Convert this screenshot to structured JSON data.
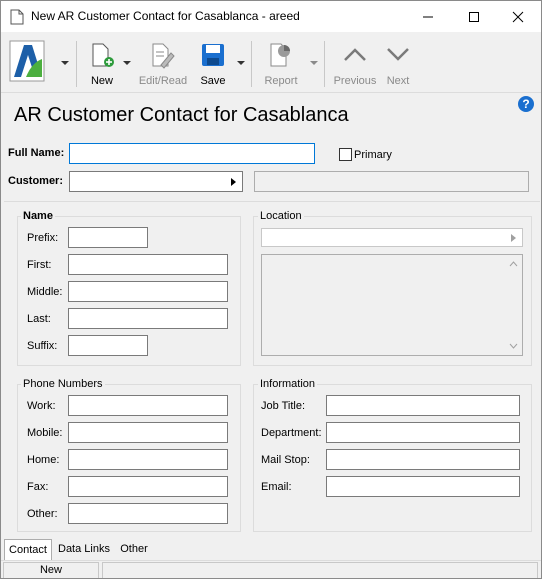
{
  "window": {
    "title": "New AR Customer Contact for Casablanca - areed"
  },
  "toolbar": {
    "new_label": "New",
    "edit_read_label": "Edit/Read",
    "save_label": "Save",
    "report_label": "Report",
    "previous_label": "Previous",
    "next_label": "Next"
  },
  "page": {
    "title": "AR Customer Contact for Casablanca",
    "help_icon": "?"
  },
  "header_fields": {
    "full_name_label": "Full Name:",
    "full_name_value": "",
    "primary_label": "Primary",
    "primary_checked": false,
    "customer_label": "Customer:",
    "customer_value": "",
    "customer_description": ""
  },
  "name_group": {
    "title": "Name",
    "prefix_label": "Prefix:",
    "first_label": "First:",
    "middle_label": "Middle:",
    "last_label": "Last:",
    "suffix_label": "Suffix:"
  },
  "location_group": {
    "title": "Location",
    "location_value": "",
    "address_text": ""
  },
  "phone_group": {
    "title": "Phone Numbers",
    "work_label": "Work:",
    "mobile_label": "Mobile:",
    "home_label": "Home:",
    "fax_label": "Fax:",
    "other_label": "Other:"
  },
  "info_group": {
    "title": "Information",
    "job_title_label": "Job Title:",
    "department_label": "Department:",
    "mail_stop_label": "Mail Stop:",
    "email_label": "Email:"
  },
  "tabs": {
    "contact": "Contact",
    "data_links": "Data Links",
    "other": "Other"
  },
  "status": {
    "mode": "New"
  }
}
